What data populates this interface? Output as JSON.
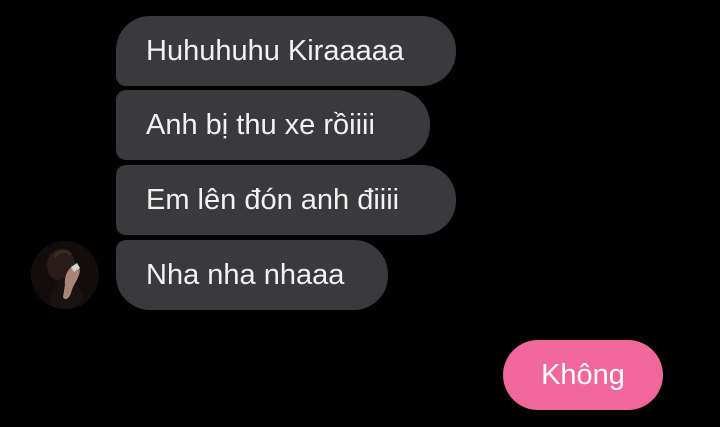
{
  "conversation": {
    "incoming_messages": [
      {
        "text": "Huhuhuhu Kiraaaaa"
      },
      {
        "text": "Anh bị thu xe rồiiii"
      },
      {
        "text": "Em lên đón anh điiii"
      },
      {
        "text": "Nha nha nhaaa"
      }
    ],
    "outgoing_messages": [
      {
        "text": "Không"
      }
    ],
    "contact_avatar": {
      "icon": "avatar-photo"
    }
  },
  "colors": {
    "background": "#000000",
    "incoming_bubble": "#3a3a3c",
    "outgoing_bubble": "#f0679c",
    "text": "#f2f2f2"
  }
}
